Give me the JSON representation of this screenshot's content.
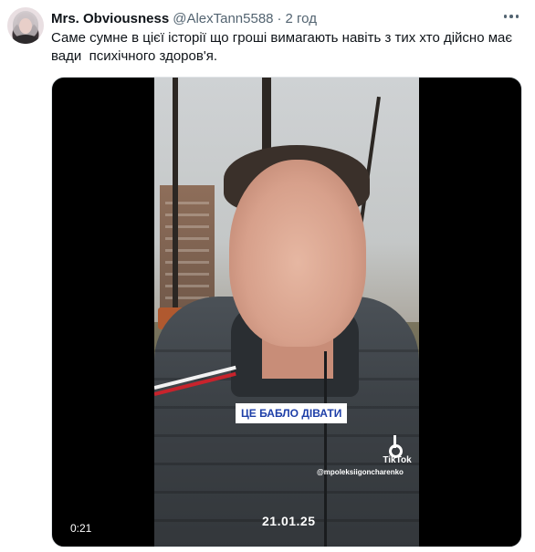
{
  "tweet": {
    "author_name": "Mrs. Obviousness",
    "handle": "@AlexTann5588",
    "separator": "·",
    "time": "2 год",
    "text": "Саме сумне в цієї історії що гроші вимагають навіть з тих хто дійсно має вади  психічного здоров'я."
  },
  "video": {
    "caption": "ЦЕ БАБЛО ДІВАТИ",
    "tiktok_label": "TikTok",
    "tiktok_handle": "@mpoleksiigoncharenko",
    "date": "21.01.25",
    "duration": "0:21"
  },
  "colors": {
    "text_primary": "#0f1419",
    "text_secondary": "#536471",
    "media_background": "#000000",
    "caption_text": "#1e3fa8"
  },
  "icons": {
    "more": "more-horizontal-icon",
    "tiktok": "tiktok-logo-icon"
  }
}
